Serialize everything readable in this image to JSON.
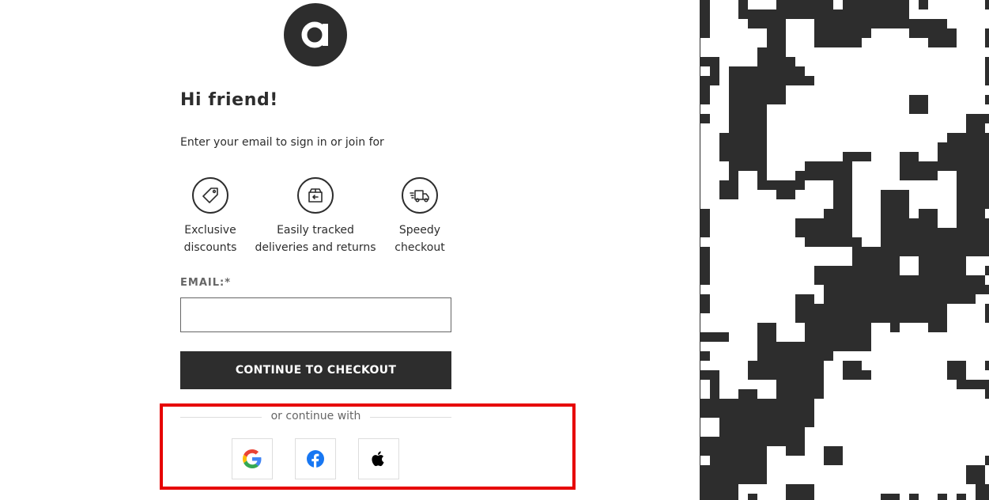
{
  "brand": {
    "logo_letter": "a",
    "logo_color": "#2d2d2d"
  },
  "header": {
    "title": "Hi friend!",
    "subtitle": "Enter your email to sign in or join for"
  },
  "benefits": [
    {
      "icon": "tag-icon",
      "label_line1": "Exclusive",
      "label_line2": "discounts"
    },
    {
      "icon": "returns-box-icon",
      "label_line1": "Easily tracked",
      "label_line2": "deliveries and returns"
    },
    {
      "icon": "delivery-truck-icon",
      "label_line1": "Speedy",
      "label_line2": "checkout"
    }
  ],
  "form": {
    "email_label": "EMAIL:*",
    "email_value": "",
    "submit_label": "CONTINUE TO CHECKOUT"
  },
  "social": {
    "divider_text": "or continue with",
    "providers": [
      {
        "name": "Google",
        "icon": "google-icon"
      },
      {
        "name": "Facebook",
        "icon": "facebook-icon"
      },
      {
        "name": "Apple",
        "icon": "apple-icon"
      }
    ]
  },
  "colors": {
    "primary": "#2d2d2d",
    "highlight": "#e60000",
    "muted": "#666666"
  }
}
